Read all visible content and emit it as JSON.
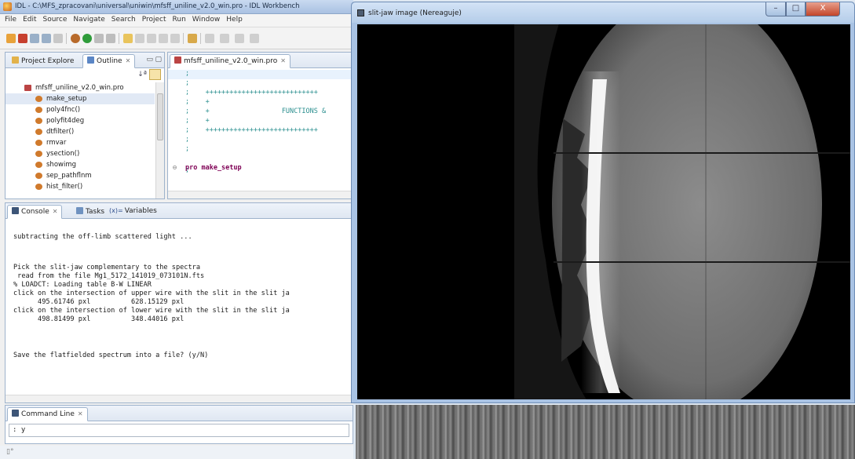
{
  "ide": {
    "title": "IDL - C:\\MFS_zpracovani\\universal\\uniwin\\mfsff_uniline_v2.0_win.pro - IDL Workbench",
    "menu": [
      "File",
      "Edit",
      "Source",
      "Navigate",
      "Search",
      "Project",
      "Run",
      "Window",
      "Help"
    ],
    "outline_tabs": [
      {
        "label": "Project Explore",
        "icon": "project-icon"
      },
      {
        "label": "Outline",
        "icon": "outline-icon"
      }
    ],
    "outline_file": "mfsff_uniline_v2.0_win.pro",
    "outline_items": [
      "make_setup",
      "poly4fnc()",
      "polyfit4deg",
      "dtfilter()",
      "rmvar",
      "ysection()",
      "showimg",
      "sep_pathflnm",
      "hist_filter()"
    ],
    "editor_tab": "mfsff_uniline_v2.0_win.pro",
    "editor_lines": [
      ";",
      ";",
      ";    ++++++++++++++++++++++++++++",
      ";    +",
      ";    +                  FUNCTIONS &",
      ";    +",
      ";    ++++++++++++++++++++++++++++",
      ";",
      ";",
      "pro make_setup",
      ";"
    ],
    "console_tabs": [
      "Console",
      "Tasks",
      "Variables"
    ],
    "console_lines": [
      "subtracting the off-limb scattered light ...",
      "",
      "",
      "Pick the slit-jaw complementary to the spectra",
      " read from the file Mg1_5172_141019_073101N.fts",
      "% LOADCT: Loading table B-W LINEAR",
      "click on the intersection of upper wire with the slit in the slit ja",
      "      495.61746 pxl          628.15129 pxl",
      "click on the intersection of lower wire with the slit in the slit ja",
      "      498.81499 pxl          348.44016 pxl",
      "",
      "",
      "",
      "Save the flatfielded spectrum into a file? (y/N)"
    ],
    "command_tab": "Command Line",
    "command_value": "y",
    "command_prompt": ":"
  },
  "slitjaw": {
    "title": "slit-jaw image (Nereaguje)",
    "minimize": "–",
    "maximize": "□",
    "close": "X"
  },
  "colors": {
    "accent": "#9eb3cc",
    "code_teal": "#2b8f8f",
    "keyword_purple": "#7f0055"
  }
}
